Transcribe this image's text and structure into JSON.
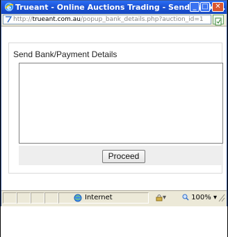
{
  "window": {
    "title": "Trueant - Online Auctions Trading - Send Bank/...",
    "buttons": {
      "minimize": "_",
      "maximize": "□",
      "close": "✕"
    }
  },
  "address_bar": {
    "url_prefix": "http://",
    "url_domain": "trueant.com.au",
    "url_path": "/popup_bank_details.php?auction_id=1"
  },
  "form": {
    "title": "Send Bank/Payment Details",
    "textarea_value": "",
    "proceed_label": "Proceed"
  },
  "status_bar": {
    "zone": "Internet",
    "zoom": "100%",
    "zoom_dropdown": "▾",
    "security_dropdown": "▾"
  },
  "colors": {
    "titlebar": "#1d54d6",
    "chrome": "#ece9d8"
  }
}
